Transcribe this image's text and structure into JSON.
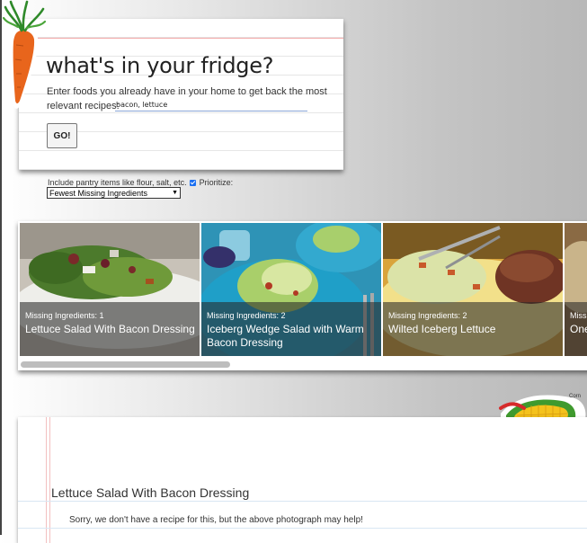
{
  "search": {
    "title": "what's in your fridge?",
    "description": "Enter foods you already have in your home to get back the most relevant recipes:",
    "input_value": "bacon, lettuce",
    "go_label": "GO!"
  },
  "options": {
    "pantry_label": "Include pantry items like flour, salt, etc.",
    "pantry_checked": true,
    "prioritize_label": "Prioritize:",
    "prioritize_value": "Fewest Missing Ingredients"
  },
  "recipes": [
    {
      "missing": "Missing Ingredients: 1",
      "name": "Lettuce Salad With Bacon Dressing"
    },
    {
      "missing": "Missing Ingredients: 2",
      "name": "Iceberg Wedge Salad with Warm Bacon Dressing"
    },
    {
      "missing": "Missing Ingredients: 2",
      "name": "Wilted Iceberg Lettuce"
    },
    {
      "missing": "Missin",
      "name": "One Che"
    }
  ],
  "corn_label": "Corn",
  "detail": {
    "title": "Lettuce Salad With Bacon Dressing",
    "message": "Sorry, we don't have a recipe for this, but the above photograph may help!"
  },
  "colors": {
    "accent_blue": "#1a6ff2",
    "overlay": "#282828",
    "carrot_orange": "#e8651c",
    "corn_yellow": "#f4c21c"
  },
  "icons": [
    "carrot-icon",
    "corn-icon",
    "checkbox-icon",
    "chevron-down-icon"
  ]
}
